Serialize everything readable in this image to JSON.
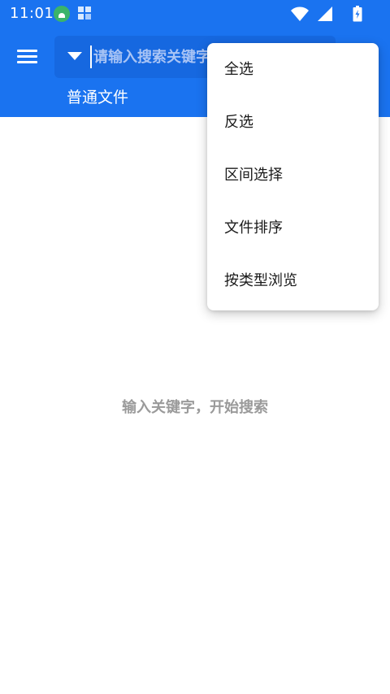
{
  "status_bar": {
    "time": "11:01"
  },
  "header": {
    "search": {
      "placeholder": "请输入搜索关键字",
      "value": ""
    },
    "tab_label": "普通文件"
  },
  "main": {
    "empty_hint": "输入关键字，开始搜索"
  },
  "popup_menu": {
    "items": [
      {
        "label": "全选"
      },
      {
        "label": "反选"
      },
      {
        "label": "区间选择"
      },
      {
        "label": "文件排序"
      },
      {
        "label": "按类型浏览"
      }
    ]
  },
  "colors": {
    "primary": "#1a73f0",
    "search_box": "#1668e0",
    "hint_text": "#9a9a9a",
    "menu_bg": "#ffffff"
  },
  "icons": {
    "menu": "hamburger-icon",
    "dropdown": "dropdown-arrow-icon",
    "wifi": "wifi-icon",
    "signal": "signal-icon",
    "battery": "battery-icon"
  }
}
